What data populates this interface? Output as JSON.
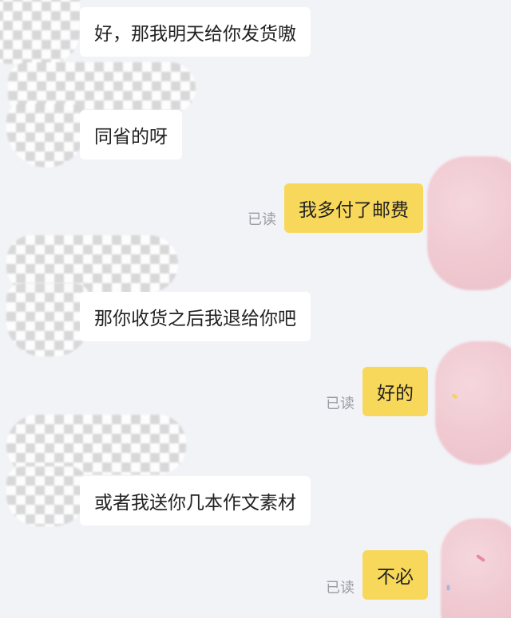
{
  "chat": {
    "read_status": "已读",
    "messages": [
      {
        "from": "other",
        "text": "好，那我明天给你发货嗷"
      },
      {
        "from": "other",
        "text": "同省的呀"
      },
      {
        "from": "me",
        "text": "我多付了邮费"
      },
      {
        "from": "other",
        "text": "那你收货之后我退给你吧"
      },
      {
        "from": "me",
        "text": "好的"
      },
      {
        "from": "other",
        "text": "或者我送你几本作文素材"
      },
      {
        "from": "me",
        "text": "不必"
      }
    ]
  },
  "colors": {
    "background": "#f2f3f7",
    "incoming_bubble": "#ffffff",
    "outgoing_bubble": "#f8d85a",
    "read_text": "#9b9ba3",
    "redacted_avatar": "#f0c9d1"
  },
  "icons": {
    "other_avatar": "checkerboard-redacted-avatar-icon",
    "my_avatar": "pink-redacted-avatar-icon"
  }
}
